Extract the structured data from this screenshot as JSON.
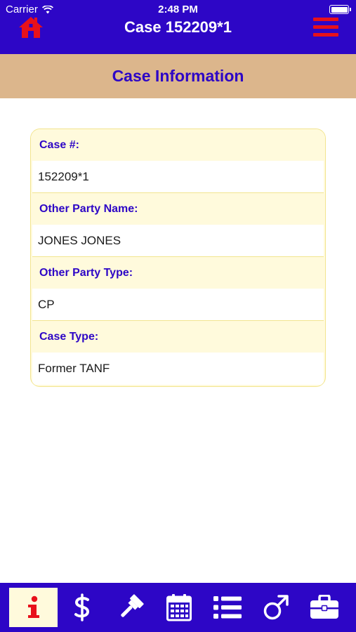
{
  "status_bar": {
    "carrier": "Carrier",
    "time": "2:48 PM",
    "wifi_icon": "wifi-icon",
    "battery_icon": "battery-icon"
  },
  "nav": {
    "title": "Case 152209*1",
    "home_icon": "home-icon",
    "menu_icon": "hamburger-menu-icon"
  },
  "section": {
    "title": "Case Information"
  },
  "case_info": {
    "fields": [
      {
        "label": "Case #:",
        "value": "152209*1"
      },
      {
        "label": "Other Party Name:",
        "value": "JONES JONES"
      },
      {
        "label": "Other Party Type:",
        "value": "CP"
      },
      {
        "label": "Case Type:",
        "value": "Former TANF"
      }
    ]
  },
  "tab_bar": {
    "tabs": [
      {
        "name": "info",
        "icon": "info-icon",
        "active": true
      },
      {
        "name": "payments",
        "icon": "dollar-icon",
        "active": false
      },
      {
        "name": "court",
        "icon": "gavel-icon",
        "active": false
      },
      {
        "name": "calendar",
        "icon": "calendar-icon",
        "active": false
      },
      {
        "name": "list",
        "icon": "list-icon",
        "active": false
      },
      {
        "name": "paternity",
        "icon": "male-symbol-icon",
        "active": false
      },
      {
        "name": "employer",
        "icon": "briefcase-icon",
        "active": false
      }
    ]
  },
  "colors": {
    "primary": "#2d06c6",
    "accent_red": "#e8111a",
    "banner": "#dcb68c",
    "card_bg": "#fffadc",
    "card_border": "#f2e58f"
  }
}
